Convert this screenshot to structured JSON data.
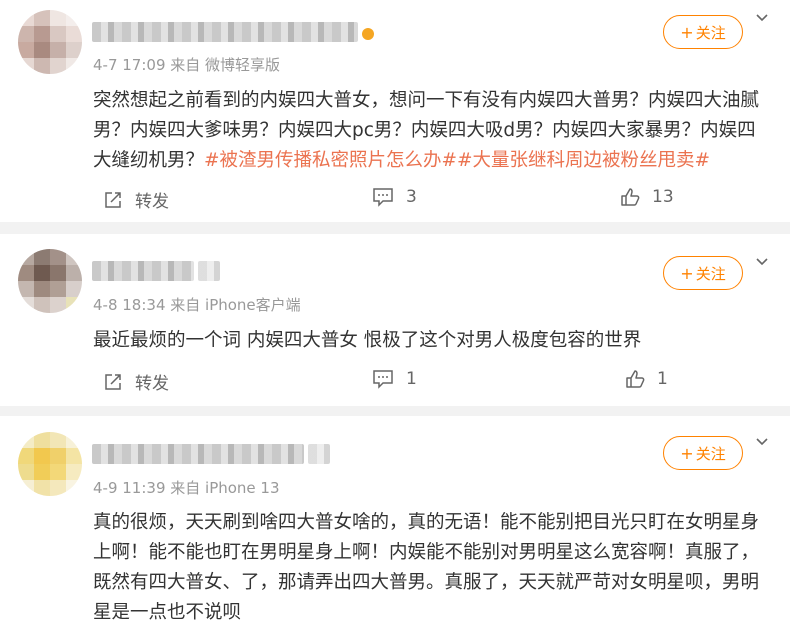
{
  "colors": {
    "accent": "#ff8200",
    "topic": "#eb7350",
    "meta": "#999999",
    "text": "#333333"
  },
  "follow_label": "关注",
  "follow_plus": "+",
  "forward_label": "转发",
  "icons": {
    "more": "chevron-down-icon",
    "forward": "share-icon",
    "comment": "comment-icon",
    "like": "thumbs-up-icon",
    "follow": "plus-icon",
    "badge": "verified-badge-icon"
  },
  "posts": [
    {
      "meta": "4-7 17:09  来自 微博轻享版",
      "text": "突然想起之前看到的内娱四大普女，想问一下有没有内娱四大普男？内娱四大油腻男？内娱四大爹味男？内娱四大pc男？内娱四大吸d男？内娱四大家暴男？内娱四大缝纫机男？",
      "topics": "#被渣男传播私密照片怎么办##大量张继科周边被粉丝甩卖#",
      "comments": "3",
      "likes": "13"
    },
    {
      "meta": "4-8 18:34  来自 iPhone客户端",
      "text": "最近最烦的一个词 内娱四大普女 恨极了这个对男人极度包容的世界",
      "topics": "",
      "comments": "1",
      "likes": "1"
    },
    {
      "meta": "4-9 11:39  来自 iPhone 13",
      "text": "真的很烦，天天刷到啥四大普女啥的，真的无语！能不能别把目光只盯在女明星身上啊！能不能也盯在男明星身上啊！内娱能不能别对男明星这么宽容啊！真服了，既然有四大普女、了，那请弄出四大普男。真服了，天天就严苛对女明星呗，男明星是一点也不说呗",
      "topics": "",
      "comments": "",
      "likes": ""
    }
  ]
}
